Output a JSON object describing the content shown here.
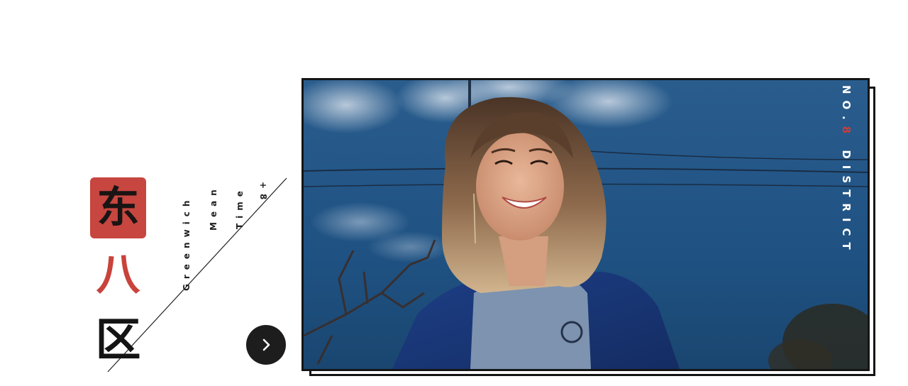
{
  "title": {
    "chars": [
      "东",
      "八",
      "区"
    ]
  },
  "subtitle_vertical": [
    "Greenwich",
    "Mean",
    "Time",
    "+8"
  ],
  "side_label": {
    "prefix": "NO.",
    "number": "8",
    "suffix": " DISTRICT"
  },
  "colors": {
    "accent_red": "#c7463f",
    "dark": "#151515"
  },
  "icons": {
    "next_button": "chevron-right-icon"
  }
}
